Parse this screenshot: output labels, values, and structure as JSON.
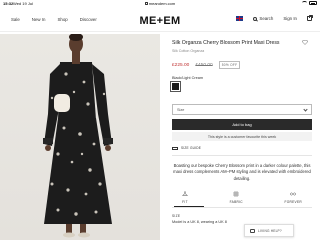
{
  "status_bar": {
    "time": "15:32",
    "date": "Wed 19 Jul",
    "url": "meandem.com"
  },
  "header": {
    "nav": [
      "Sale",
      "New In",
      "Shop",
      "Discover"
    ],
    "logo": "ME+EM",
    "search_label": "Search",
    "signin_label": "Sign In"
  },
  "product": {
    "title": "Silk Organza Cherry Blossom Print Maxi Dress",
    "subtitle": "Silk Cotton Organza",
    "price_now": "£225.00",
    "price_was": "£450.00",
    "badge": "50% OFF",
    "colour_label": "Black/Light Cream",
    "size_placeholder": "Size",
    "add_to_bag": "Add to bag",
    "favourite_note": "This style is a customer favourite this week",
    "size_guide": "SIZE GUIDE",
    "description": "Boasting our bespoke Cherry Blossom print in a darker colour palette, this maxi dress complements AM–PM styling and is elevated with embroidered detailing.",
    "tabs": [
      "FIT",
      "FABRIC",
      "FOREVER"
    ],
    "size_heading": "SIZE",
    "model_line": "Model is a UK 8, wearing a UK 8"
  },
  "chat": {
    "label": "LIVING HELP?"
  },
  "colors": {
    "sale_red": "#c03434",
    "button_dark": "#2a2a2a",
    "dress": "#1c1c1c"
  }
}
